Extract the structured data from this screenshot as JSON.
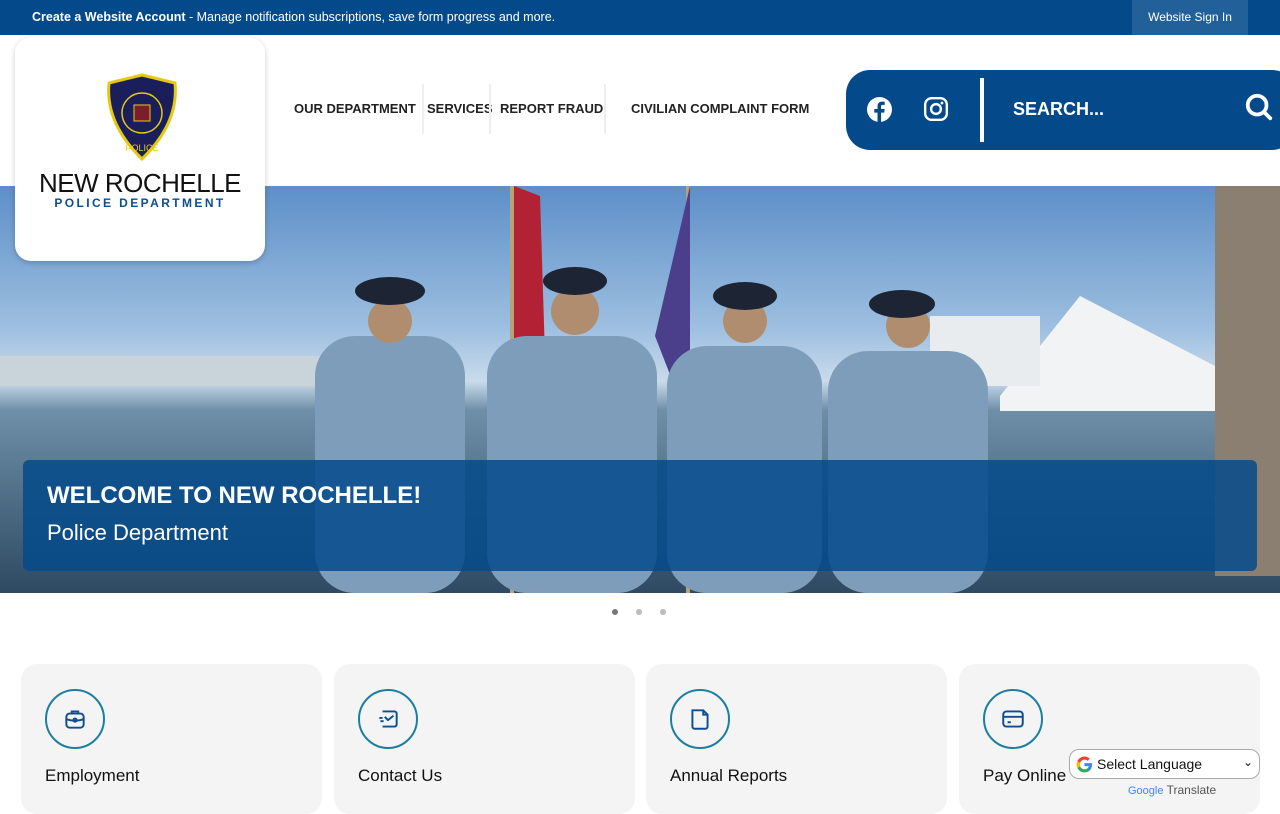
{
  "topbar": {
    "create_link": "Create a Website Account",
    "message": " - Manage notification subscriptions, save form progress and more.",
    "sign_in": "Website Sign In"
  },
  "logo": {
    "badge_text": "NEW ROCHELLE POLICE",
    "line1": "NEW ROCHELLE",
    "line2": "POLICE DEPARTMENT"
  },
  "nav": {
    "items": [
      "OUR DEPARTMENT",
      "SERVICES",
      "REPORT FRAUD",
      "CIVILIAN COMPLAINT FORM"
    ]
  },
  "search": {
    "placeholder": "SEARCH...",
    "icons": [
      "facebook-icon",
      "instagram-icon",
      "search-icon"
    ]
  },
  "hero": {
    "title": "WELCOME TO NEW ROCHELLE!",
    "subtitle": "Police Department",
    "slides": 3,
    "active_slide": 1
  },
  "cards": [
    {
      "label": "Employment",
      "icon": "briefcase-icon"
    },
    {
      "label": "Contact Us",
      "icon": "message-icon"
    },
    {
      "label": "Annual Reports",
      "icon": "folder-icon"
    },
    {
      "label": "Pay Online",
      "icon": "credit-card-icon"
    }
  ],
  "translate": {
    "select": "Select Language",
    "google": "Google",
    "translate": "Translate"
  },
  "colors": {
    "brand": "#044a8b",
    "accent": "#1c7fa0"
  }
}
